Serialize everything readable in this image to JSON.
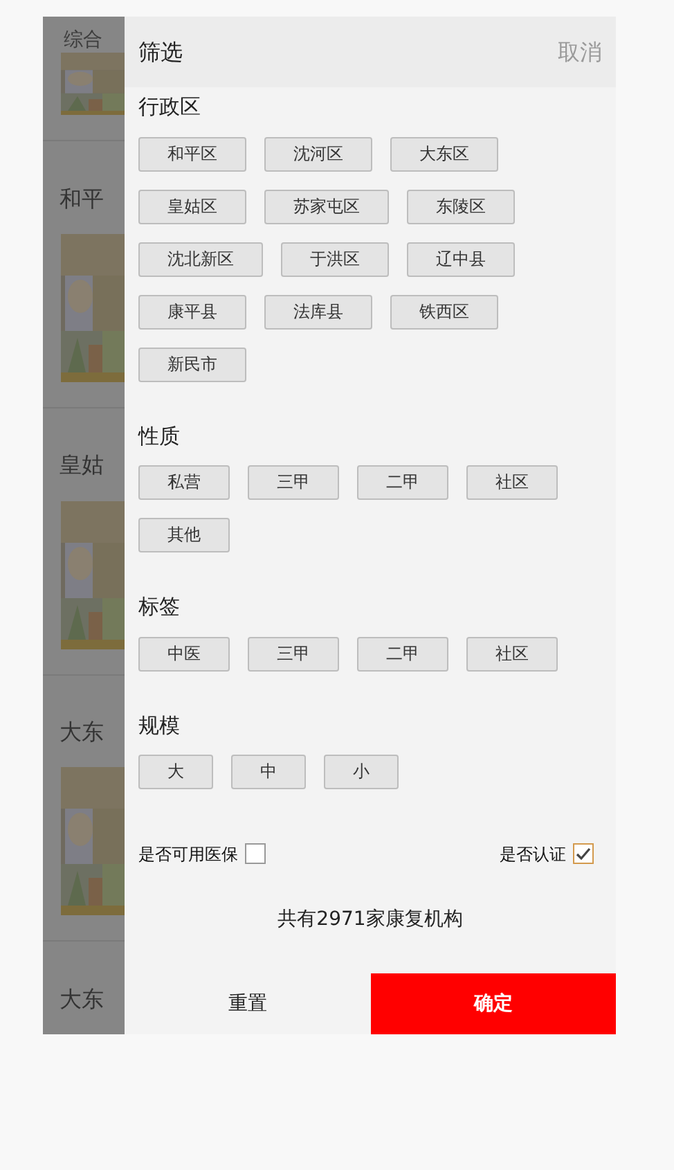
{
  "background_list": {
    "tab": "综合",
    "items": [
      {
        "title": "和平"
      },
      {
        "title": "皇姑"
      },
      {
        "title": "大东"
      },
      {
        "title": "大东"
      }
    ]
  },
  "filter": {
    "title": "筛选",
    "cancel": "取消",
    "sections": [
      {
        "title": "行政区",
        "options": [
          {
            "label": "和平区",
            "selected": false
          },
          {
            "label": "沈河区",
            "selected": false
          },
          {
            "label": "大东区",
            "selected": false
          },
          {
            "label": "皇姑区",
            "selected": false
          },
          {
            "label": "苏家屯区",
            "selected": false
          },
          {
            "label": "东陵区",
            "selected": false
          },
          {
            "label": "沈北新区",
            "selected": false
          },
          {
            "label": "于洪区",
            "selected": false
          },
          {
            "label": "辽中县",
            "selected": false
          },
          {
            "label": "康平县",
            "selected": false
          },
          {
            "label": "法库县",
            "selected": false
          },
          {
            "label": "铁西区",
            "selected": false
          },
          {
            "label": "新民市",
            "selected": false
          }
        ]
      },
      {
        "title": "性质",
        "options": [
          {
            "label": "私营",
            "selected": false
          },
          {
            "label": "三甲",
            "selected": false
          },
          {
            "label": "二甲",
            "selected": false
          },
          {
            "label": "社区",
            "selected": false
          },
          {
            "label": "其他",
            "selected": false
          }
        ]
      },
      {
        "title": "标签",
        "options": [
          {
            "label": "中医",
            "selected": false
          },
          {
            "label": "三甲",
            "selected": false
          },
          {
            "label": "二甲",
            "selected": false
          },
          {
            "label": "社区",
            "selected": false
          }
        ]
      },
      {
        "title": "规模",
        "options": [
          {
            "label": "大",
            "selected": false
          },
          {
            "label": "中",
            "selected": false
          },
          {
            "label": "小",
            "selected": false
          }
        ]
      }
    ],
    "toggles": [
      {
        "label": "是否可用医保",
        "checked": false
      },
      {
        "label": "是否认证",
        "checked": true
      }
    ],
    "count": "共有2971家康复机构",
    "buttons": {
      "reset": "重置",
      "confirm": "确定"
    }
  }
}
